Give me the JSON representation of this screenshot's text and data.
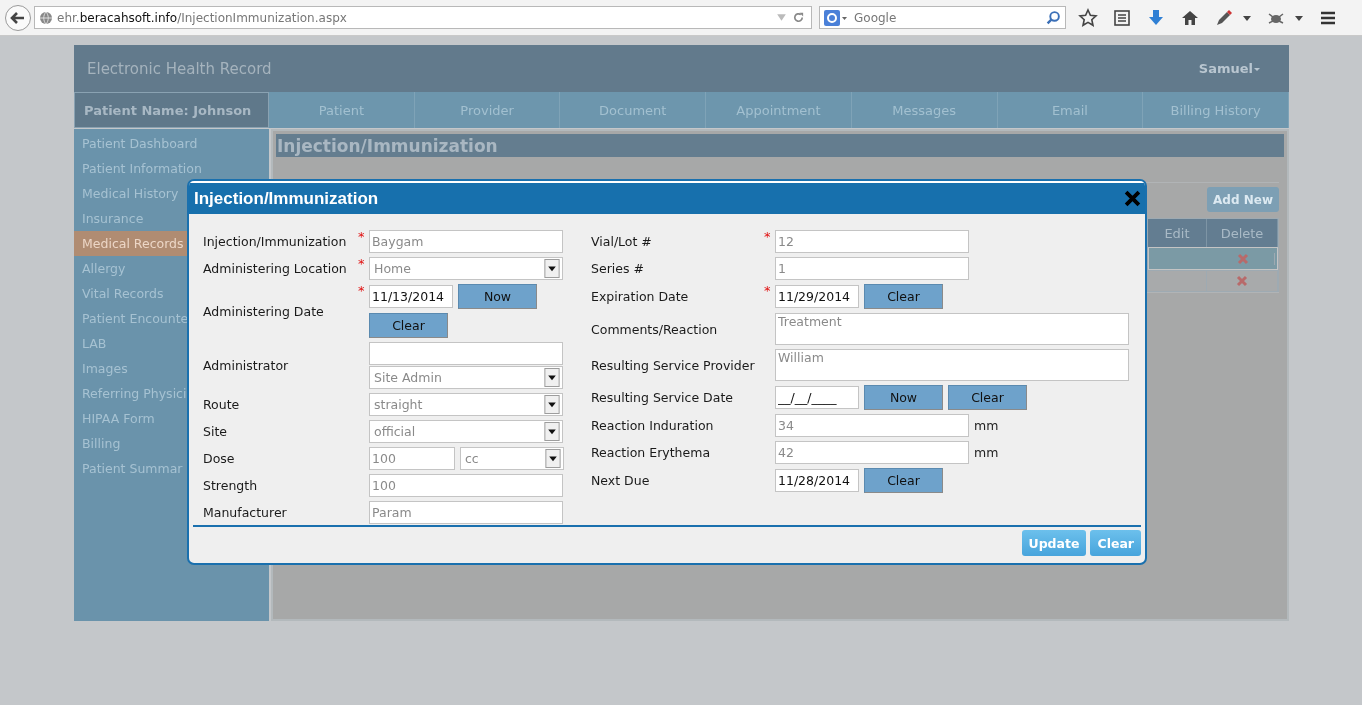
{
  "browser": {
    "url": "ehr.**beracahsoft.info**/InjectionImmunization.aspx",
    "search": {
      "placeholder": "Google"
    }
  },
  "app": {
    "title": "Electronic Health Record",
    "user": "Samuel"
  },
  "patient_name": "Patient Name: Johnson",
  "tabs": [
    "Patient",
    "Provider",
    "Document",
    "Appointment",
    "Messages",
    "Email",
    "Billing History"
  ],
  "sidebar": {
    "items": [
      {
        "label": "Patient Dashboard",
        "selected": false
      },
      {
        "label": "Patient Information",
        "selected": false
      },
      {
        "label": "Medical History",
        "selected": false
      },
      {
        "label": "Insurance",
        "selected": false
      },
      {
        "label": "Medical Records",
        "selected": true
      },
      {
        "label": "Allergy",
        "selected": false
      },
      {
        "label": "Vital Records",
        "selected": false
      },
      {
        "label": "Patient Encounte",
        "selected": false
      },
      {
        "label": "LAB",
        "selected": false
      },
      {
        "label": "Images",
        "selected": false
      },
      {
        "label": "Referring Physici",
        "selected": false
      },
      {
        "label": "HIPAA Form",
        "selected": false
      },
      {
        "label": "Billing",
        "selected": false
      },
      {
        "label": "Patient Summar",
        "selected": false
      }
    ]
  },
  "page": {
    "title": "Injection/Immunization",
    "add_button": "Add New",
    "table": {
      "columns": [
        "Edit",
        "Delete"
      ],
      "rows": [
        {
          "selected": true
        },
        {
          "selected": false
        }
      ]
    }
  },
  "dialog": {
    "title": "Injection/Immunization",
    "required_mark": "*",
    "left_fields": [
      {
        "label": "Injection/Immunization",
        "required": true,
        "kind": "text",
        "value": "Baygam"
      },
      {
        "label": "Administering Location",
        "required": true,
        "kind": "select",
        "value": "Home"
      },
      {
        "label": "Administering Date",
        "required": true,
        "kind": "date_stacked",
        "value": "11/13/2014",
        "buttons": [
          "Now",
          "Clear"
        ]
      },
      {
        "label": "Administrator",
        "required": false,
        "kind": "text_select",
        "option": "Site Admin"
      },
      {
        "label": "Route",
        "required": false,
        "kind": "select",
        "value": "straight"
      },
      {
        "label": "Site",
        "required": false,
        "kind": "select",
        "value": "official"
      },
      {
        "label": "Dose",
        "required": false,
        "kind": "dose",
        "value": "100",
        "option": "cc"
      },
      {
        "label": "Strength",
        "required": false,
        "kind": "text",
        "value": "100"
      },
      {
        "label": "Manufacturer",
        "required": false,
        "kind": "text",
        "value": "Param"
      }
    ],
    "right_fields": [
      {
        "label": "Vial/Lot #",
        "required": true,
        "kind": "text",
        "value": "12"
      },
      {
        "label": "Series #",
        "required": false,
        "kind": "text",
        "value": "1"
      },
      {
        "label": "Expiration Date",
        "required": true,
        "kind": "date",
        "value": "11/29/2014",
        "buttons": [
          "Clear"
        ]
      },
      {
        "label": "Comments/Reaction",
        "required": false,
        "kind": "textarea",
        "value": "Treatment"
      },
      {
        "label": "Resulting Service Provider",
        "required": false,
        "kind": "textarea",
        "value": "William"
      },
      {
        "label": "Resulting Service Date",
        "required": false,
        "kind": "date",
        "value": "__/__/____",
        "buttons": [
          "Now",
          "Clear"
        ]
      },
      {
        "label": "Reaction Induration",
        "required": false,
        "kind": "text",
        "value": "34",
        "unit": "mm"
      },
      {
        "label": "Reaction Erythema",
        "required": false,
        "kind": "text",
        "value": "42",
        "unit": "mm"
      },
      {
        "label": "Next Due",
        "required": false,
        "kind": "date",
        "value": "11/28/2014",
        "buttons": [
          "Clear"
        ]
      }
    ],
    "buttons": [
      "Update",
      "Clear"
    ]
  }
}
